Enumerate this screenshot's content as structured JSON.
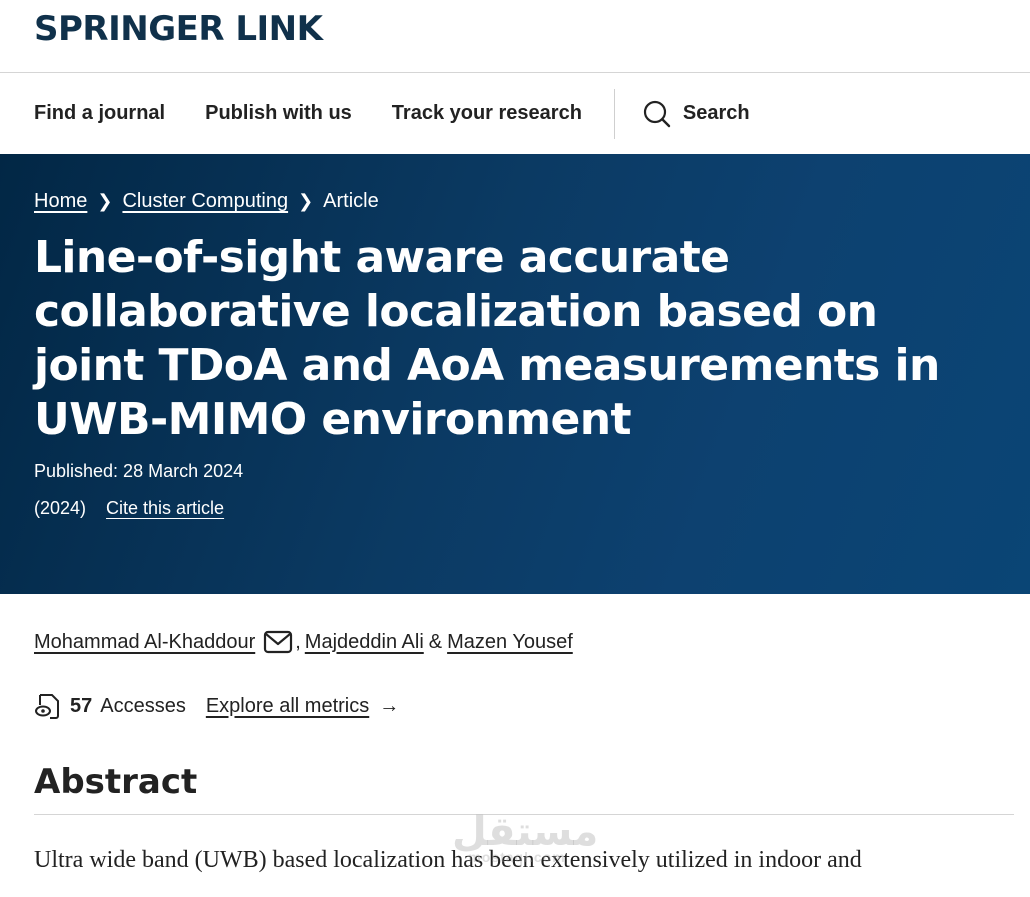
{
  "brand": {
    "logo": "SPRINGER LINK"
  },
  "nav": {
    "links": [
      "Find a journal",
      "Publish with us",
      "Track your research"
    ],
    "search_label": "Search"
  },
  "breadcrumb": {
    "home": "Home",
    "journal": "Cluster Computing",
    "current": "Article"
  },
  "article": {
    "title": "Line-of-sight aware accurate collaborative localization based on joint TDoA and AoA measurements in UWB-MIMO environment",
    "published": "Published: 28 March 2024",
    "year": "(2024)",
    "cite_link": "Cite this article"
  },
  "authors": {
    "list": [
      "Mohammad Al-Khaddour",
      "Majdeddin Ali",
      "Mazen Yousef"
    ],
    "separator": ",",
    "ampersand": "&"
  },
  "metrics": {
    "accesses_count": "57",
    "accesses_label": "Accesses",
    "explore_link": "Explore all metrics"
  },
  "abstract": {
    "heading": "Abstract",
    "first_line": "Ultra wide band (UWB) based localization has been extensively utilized in indoor and"
  },
  "watermark": {
    "arabic": "مستقل",
    "latin": "mostaql.com"
  },
  "colors": {
    "brand": "#10314b",
    "hero_start": "#022745",
    "hero_end": "#0a4575"
  }
}
